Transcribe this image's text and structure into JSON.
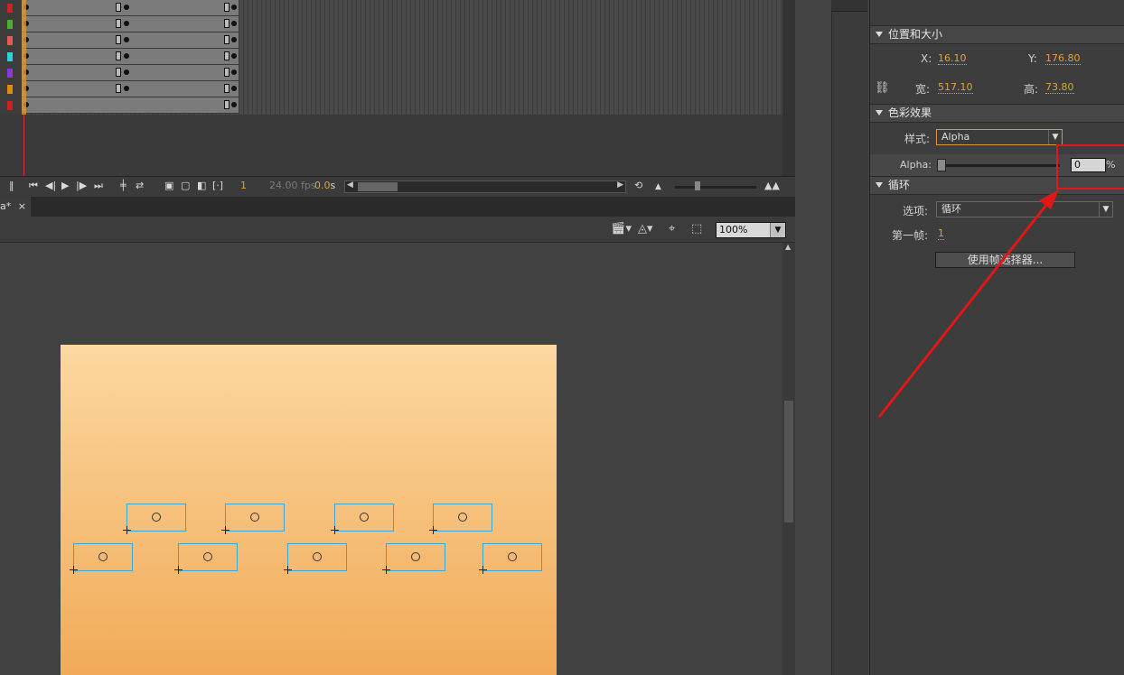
{
  "timeline": {
    "layers": [
      {
        "color": "#cc2222"
      },
      {
        "color": "#4caf2a"
      },
      {
        "color": "#e05a5a"
      },
      {
        "color": "#2ad4d4"
      },
      {
        "color": "#8a3ad4"
      },
      {
        "color": "#e08a10"
      },
      {
        "color": "#cc2222"
      }
    ],
    "current_frame": "1",
    "fps": "24.00 fps",
    "time": "0.0",
    "time_unit": "s"
  },
  "document": {
    "tab_label": "a*",
    "close_glyph": "×",
    "zoom": "100%"
  },
  "properties": {
    "position_size": {
      "header": "位置和大小",
      "x_label": "X:",
      "x_value": "16.10",
      "y_label": "Y:",
      "y_value": "176.80",
      "w_label": "宽:",
      "w_value": "517.10",
      "h_label": "高:",
      "h_value": "73.80"
    },
    "color_effect": {
      "header": "色彩效果",
      "style_label": "样式:",
      "style_value": "Alpha",
      "alpha_label": "Alpha:",
      "alpha_value": "0",
      "alpha_unit": "%",
      "alpha_level": 0
    },
    "loop": {
      "header": "循环",
      "option_label": "选项:",
      "option_value": "循环",
      "first_frame_label": "第一帧:",
      "first_frame_value": "1",
      "frame_picker_button": "使用帧选择器..."
    }
  },
  "annotation": {
    "color": "#e01818"
  }
}
